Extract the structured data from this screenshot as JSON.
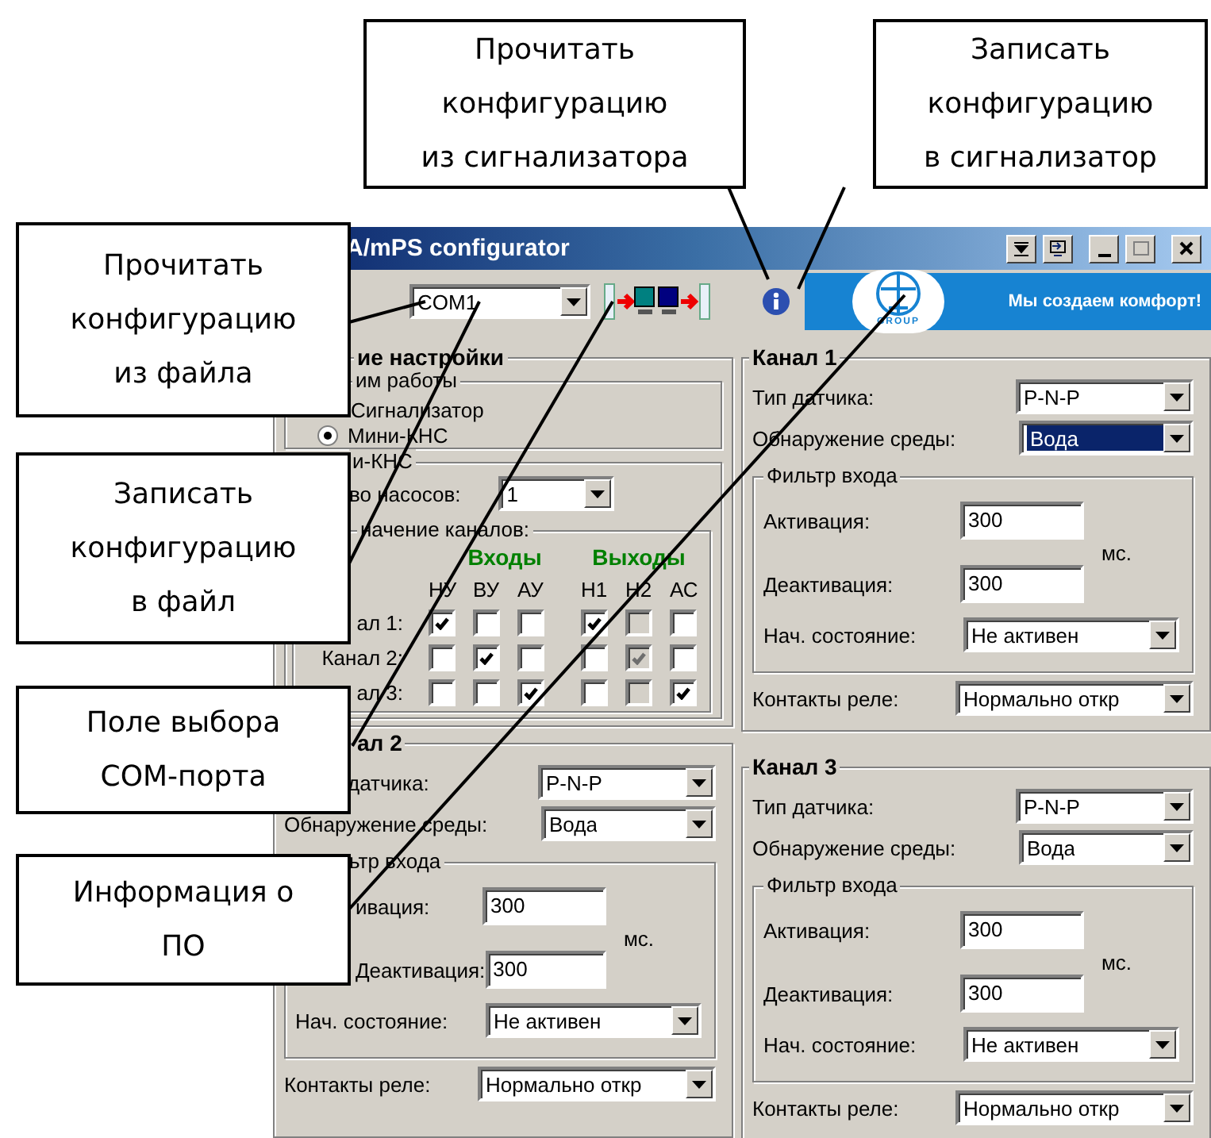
{
  "window": {
    "title": "A/mPS configurator"
  },
  "toolbar": {
    "com_port": "COM1",
    "banner_text": "Мы создаем комфорт!",
    "logo_caption": "GROUP"
  },
  "general": {
    "title": "ие настройки",
    "mode": {
      "title": "им работы",
      "options": [
        {
          "label": "Сигнализатор"
        },
        {
          "label": "Мини-КНС",
          "selected": true
        }
      ]
    },
    "mini_kns": {
      "title": "и-КНС",
      "pumps_label": "во насосов:",
      "pumps": "1",
      "assign_title": "начение каналов:",
      "inputs_label": "Входы",
      "outputs_label": "Выходы",
      "columns": [
        "НУ",
        "ВУ",
        "АУ",
        "Н1",
        "Н2",
        "АС"
      ],
      "rows": [
        {
          "label": "ал 1:",
          "checks": [
            {
              "checked": true,
              "disabled": false
            },
            {
              "checked": false,
              "disabled": false
            },
            {
              "checked": false,
              "disabled": false
            },
            {
              "checked": true,
              "disabled": false
            },
            {
              "checked": false,
              "disabled": true
            },
            {
              "checked": false,
              "disabled": false
            }
          ]
        },
        {
          "label": "Канал 2:",
          "checks": [
            {
              "checked": false,
              "disabled": false
            },
            {
              "checked": true,
              "disabled": false
            },
            {
              "checked": false,
              "disabled": false
            },
            {
              "checked": false,
              "disabled": false
            },
            {
              "checked": true,
              "disabled": true
            },
            {
              "checked": false,
              "disabled": false
            }
          ]
        },
        {
          "label": "ал 3:",
          "checks": [
            {
              "checked": false,
              "disabled": false
            },
            {
              "checked": false,
              "disabled": false
            },
            {
              "checked": true,
              "disabled": false
            },
            {
              "checked": false,
              "disabled": false
            },
            {
              "checked": false,
              "disabled": true
            },
            {
              "checked": true,
              "disabled": false
            }
          ]
        }
      ]
    }
  },
  "channels": [
    {
      "title": "Канал 1",
      "sensor_label": "Тип датчика:",
      "sensor": "P-N-P",
      "medium_label": "Обнаружение среды:",
      "medium": "Вода",
      "medium_focused": true,
      "filter_title": "Фильтр входа",
      "activation_label": "Активация:",
      "activation": "300",
      "unit": "мс.",
      "deactivation_label": "Деактивация:",
      "deactivation": "300",
      "initial_label": "Нач. состояние:",
      "initial": "Не активен",
      "relay_label": "Контакты реле:",
      "relay": "Нормально откр"
    },
    {
      "title": "ал 2",
      "sensor_label": "датчика:",
      "sensor": "P-N-P",
      "medium_label": "Обнаружение среды:",
      "medium": "Вода",
      "medium_focused": false,
      "filter_title": "ьтр входа",
      "activation_label": "ивация:",
      "activation": "300",
      "unit": "мс.",
      "deactivation_label": "Деактивация:",
      "deactivation": "300",
      "initial_label": "Нач. состояние:",
      "initial": "Не активен",
      "relay_label": "Контакты реле:",
      "relay": "Нормально откр"
    },
    {
      "title": "Канал 3",
      "sensor_label": "Тип датчика:",
      "sensor": "P-N-P",
      "medium_label": "Обнаружение среды:",
      "medium": "Вода",
      "medium_focused": false,
      "filter_title": "Фильтр входа",
      "activation_label": "Активация:",
      "activation": "300",
      "unit": "мс.",
      "deactivation_label": "Деактивация:",
      "deactivation": "300",
      "initial_label": "Нач. состояние:",
      "initial": "Не активен",
      "relay_label": "Контакты реле:",
      "relay": "Нормально откр"
    }
  ],
  "callouts": [
    {
      "text": "Прочитать\nконфигурацию\nиз сигнализатора"
    },
    {
      "text": "Записать\nконфигурацию\nв сигнализатор"
    },
    {
      "text": "Прочитать\nконфигурацию\nиз файла"
    },
    {
      "text": "Записать\nконфигурацию\nв файл"
    },
    {
      "text": "Поле выбора\nCOM-порта"
    },
    {
      "text": "Информация о\nПО"
    }
  ]
}
